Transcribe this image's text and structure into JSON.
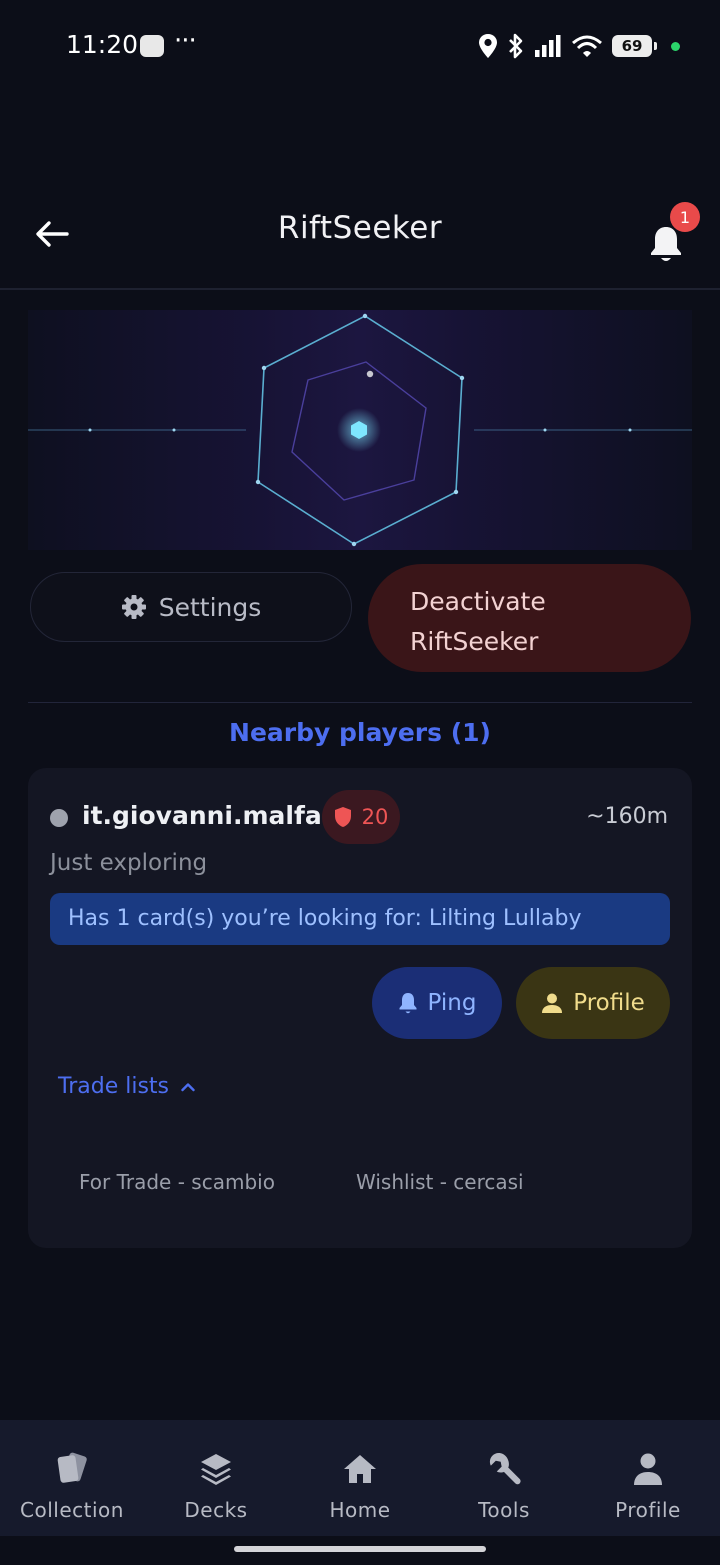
{
  "status_bar": {
    "time": "11:20",
    "dots": "···",
    "battery": "69"
  },
  "header": {
    "title": "RiftSeeker",
    "notification_count": "1"
  },
  "actions": {
    "settings_label": "Settings",
    "deactivate_line1": "Deactivate",
    "deactivate_line2": "RiftSeeker"
  },
  "nearby": {
    "title": "Nearby players (1)"
  },
  "player": {
    "name": "it.giovanni.malfa",
    "rank": "20",
    "distance": "~160m",
    "status": "Just exploring",
    "match_text": "Has 1 card(s) you’re looking for: Lilting Lullaby",
    "ping_label": "Ping",
    "profile_label": "Profile",
    "trade_lists_label": "Trade lists",
    "trade_lists": [
      "For Trade - scambio",
      "Wishlist - cercasi"
    ]
  },
  "bottom_nav": {
    "items": [
      {
        "label": "Collection",
        "icon": "cards-icon"
      },
      {
        "label": "Decks",
        "icon": "layers-icon"
      },
      {
        "label": "Home",
        "icon": "home-icon"
      },
      {
        "label": "Tools",
        "icon": "wrench-icon"
      },
      {
        "label": "Profile",
        "icon": "person-icon"
      }
    ]
  },
  "colors": {
    "background": "#0c0e18",
    "accent_blue": "#4d6ef0",
    "danger": "#3a1518",
    "rank_red": "#ee5555"
  }
}
